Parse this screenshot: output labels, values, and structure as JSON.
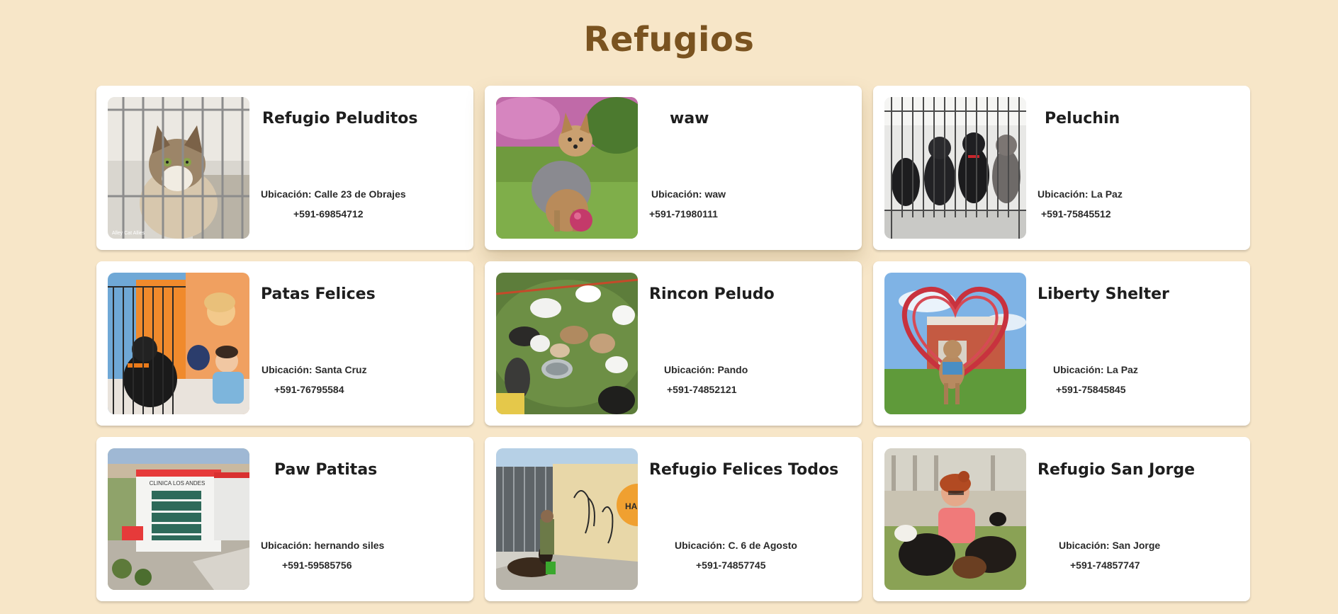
{
  "page": {
    "title": "Refugios"
  },
  "location_prefix": "Ubicación:",
  "shelters": [
    {
      "name": "Refugio Peluditos",
      "location": "Calle 23 de Obrajes",
      "phone": "+591-69854712",
      "photo": "cat-behind-cage-photo",
      "photo_text": "Alley Cat Allies"
    },
    {
      "name": "waw",
      "location": "waw",
      "phone": "+591-71980111",
      "photo": "yorkshire-terrier-with-ball-photo"
    },
    {
      "name": "Peluchin",
      "location": "La Paz",
      "phone": "+591-75845512",
      "photo": "puppies-in-kennel-photo"
    },
    {
      "name": "Patas Felices",
      "location": "Santa Cruz",
      "phone": "+591-76795584",
      "photo": "child-and-dog-at-shelter-photo"
    },
    {
      "name": "Rincon Peludo",
      "location": "Pando",
      "phone": "+591-74852121",
      "photo": "puppies-on-grass-photo"
    },
    {
      "name": "Liberty Shelter",
      "location": "La Paz",
      "phone": "+591-75845845",
      "photo": "dog-under-heart-sculpture-photo"
    },
    {
      "name": "Paw Patitas",
      "location": "hernando siles",
      "phone": "+591-59585756",
      "photo": "clinic-building-aerial-photo",
      "photo_text": "CLINICA LOS ANDES"
    },
    {
      "name": "Refugio Felices Todos",
      "location": "C. 6 de Agosto",
      "phone": "+591-74857745",
      "photo": "dog-kennels-with-mural-photo",
      "photo_text": "HACH"
    },
    {
      "name": "Refugio San Jorge",
      "location": "San Jorge",
      "phone": "+591-74857747",
      "photo": "woman-with-dogs-in-park-photo"
    }
  ],
  "colors": {
    "background": "#f7e6c8",
    "title": "#7a5320",
    "card": "#ffffff",
    "text": "#1e1e1e"
  }
}
